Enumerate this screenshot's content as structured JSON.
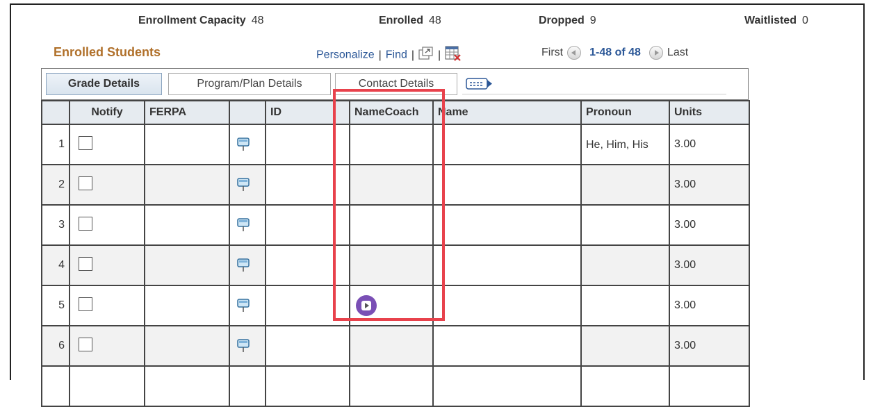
{
  "stats": {
    "capacity_label": "Enrollment Capacity",
    "capacity_value": "48",
    "enrolled_label": "Enrolled",
    "enrolled_value": "48",
    "dropped_label": "Dropped",
    "dropped_value": "9",
    "waitlisted_label": "Waitlisted",
    "waitlisted_value": "0"
  },
  "grid": {
    "title": "Enrolled Students",
    "personalize": "Personalize",
    "find": "Find",
    "sep": "|",
    "first": "First",
    "range": "1-48 of 48",
    "last": "Last"
  },
  "tabs": [
    "Grade Details",
    "Program/Plan Details",
    "Contact Details"
  ],
  "columns": {
    "notify": "Notify",
    "ferpa": "FERPA",
    "id": "ID",
    "namecoach": "NameCoach",
    "name": "Name",
    "pronoun": "Pronoun",
    "units": "Units"
  },
  "rows": [
    {
      "num": "1",
      "pronoun": "He, Him, His",
      "units": "3.00"
    },
    {
      "num": "2",
      "pronoun": "",
      "units": "3.00"
    },
    {
      "num": "3",
      "pronoun": "",
      "units": "3.00"
    },
    {
      "num": "4",
      "pronoun": "",
      "units": "3.00"
    },
    {
      "num": "5",
      "pronoun": "",
      "units": "3.00"
    },
    {
      "num": "6",
      "pronoun": "",
      "units": "3.00"
    }
  ],
  "colors": {
    "title": "#b0702a",
    "link": "#2b5797",
    "highlight": "#e8424c",
    "namecoach_button": "#7a4fb5"
  },
  "icons": {
    "view_all": "new-window-icon",
    "download": "spreadsheet-download-icon",
    "show_all_columns": "show-columns-icon",
    "photo": "student-pin-icon",
    "namecoach_play": "play-icon"
  }
}
